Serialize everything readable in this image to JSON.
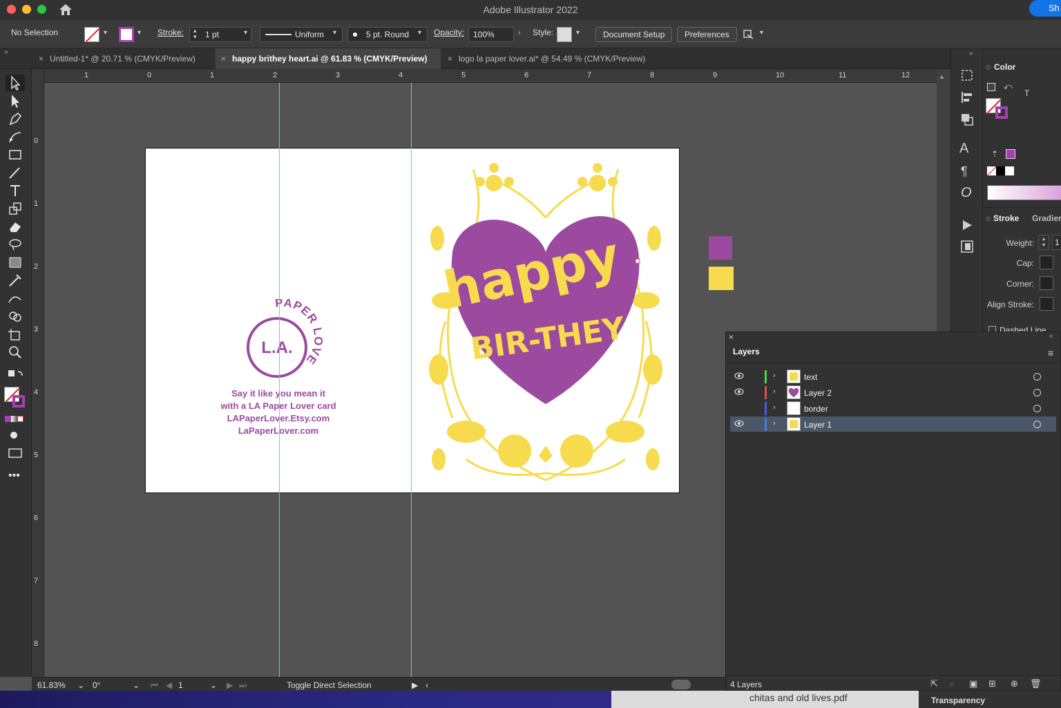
{
  "window": {
    "app_title": "Adobe Illustrator 2022",
    "share_label": "Sh"
  },
  "controlbar": {
    "selection": "No Selection",
    "stroke_label": "Stroke:",
    "stroke_weight": "1 pt",
    "profile": "Uniform",
    "brush": "5 pt. Round",
    "opacity_label": "Opacity:",
    "opacity_value": "100%",
    "style_label": "Style:",
    "document_setup": "Document Setup",
    "preferences": "Preferences"
  },
  "tabs": [
    {
      "label": "Untitled-1* @ 20.71 % (CMYK/Preview)",
      "active": false
    },
    {
      "label": "happy brithey heart.ai @ 61.83 % (CMYK/Preview)",
      "active": true
    },
    {
      "label": "logo la paper lover.ai* @ 54.49 % (CMYK/Preview)",
      "active": false
    }
  ],
  "rulers": {
    "horizontal": [
      "1",
      "0",
      "1",
      "2",
      "3",
      "4",
      "5",
      "6",
      "7",
      "8",
      "9",
      "10",
      "11",
      "12"
    ],
    "vertical": [
      "0",
      "1",
      "2",
      "3",
      "4",
      "5",
      "6",
      "7",
      "8"
    ]
  },
  "artboard": {
    "logo_word": "L.A.",
    "logo_arc": "PAPER LOVER",
    "tagline": [
      "Say it like you mean it",
      "with a LA Paper Lover card",
      "LAPaperLover.Etsy.com",
      "LaPaperLover.com"
    ],
    "headline_1": "happy",
    "headline_2": "BIR-THEY",
    "colors": {
      "purple": "#9b4a9f",
      "yellow": "#f7db4f"
    }
  },
  "color_panel": {
    "color_tab": "Color",
    "stroke_tab": "Stroke",
    "gradient_tab": "Gradier",
    "weight_label": "Weight:",
    "weight_value": "1",
    "cap_label": "Cap:",
    "corner_label": "Corner:",
    "align_label": "Align Stroke:",
    "dashed_label": "Dashed Line",
    "t_label": "T"
  },
  "layers_panel": {
    "title": "Layers",
    "rows": [
      {
        "name": "text",
        "color": "#4fd44f",
        "visible": true,
        "selected": false
      },
      {
        "name": "Layer 2",
        "color": "#e0504a",
        "visible": true,
        "selected": false
      },
      {
        "name": "border",
        "color": "#4a57e0",
        "visible": false,
        "selected": false
      },
      {
        "name": "Layer 1",
        "color": "#4a7de0",
        "visible": true,
        "selected": true
      }
    ],
    "count": "4 Layers"
  },
  "statusbar": {
    "zoom": "61.83%",
    "rotation": "0°",
    "artboard_num": "1",
    "tool_hint": "Toggle Direct Selection"
  },
  "dock": {
    "file": "chitas and old lives.pdf",
    "transparency": "Transparency"
  }
}
